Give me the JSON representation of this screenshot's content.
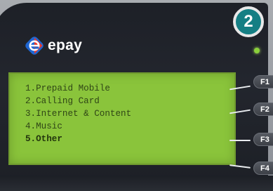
{
  "step": {
    "number": "2"
  },
  "brand": {
    "name": "epay",
    "logo_icon": "epay-logo-icon"
  },
  "screen": {
    "menu": [
      {
        "label": "1.Prepaid Mobile"
      },
      {
        "label": "2.Calling Card"
      },
      {
        "label": "3.Internet & Content"
      },
      {
        "label": "4.Music"
      },
      {
        "label": "5.Other",
        "selected": true
      }
    ]
  },
  "function_keys": [
    {
      "label": "F1"
    },
    {
      "label": "F2"
    },
    {
      "label": "F3"
    },
    {
      "label": "F4"
    }
  ],
  "colors": {
    "screen_background": "#8ac43b",
    "screen_text": "#2f4516",
    "step_badge": "#157f84",
    "housing": "#1d2027",
    "status_led": "#8ad03b"
  }
}
